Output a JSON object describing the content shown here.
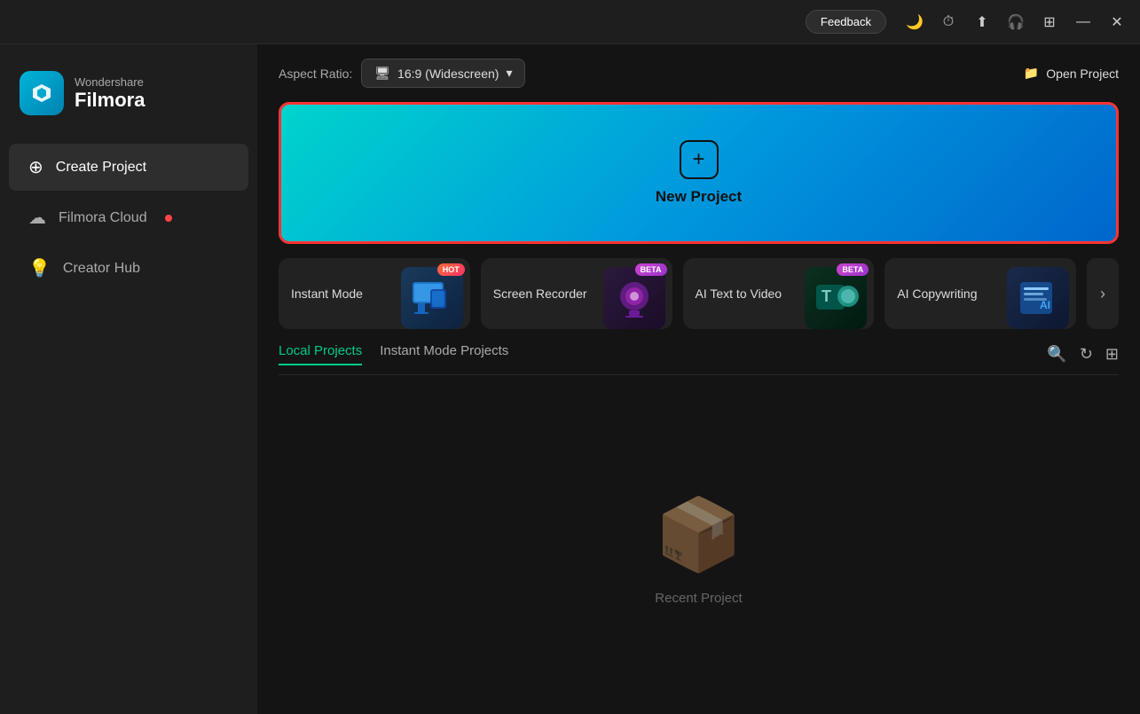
{
  "titleBar": {
    "feedback": "Feedback",
    "minimize": "—",
    "restore": "⊡",
    "close": "✕"
  },
  "logo": {
    "wonder": "Wondershare",
    "filmora": "Filmora"
  },
  "nav": {
    "createProject": "Create Project",
    "filmoraCloud": "Filmora Cloud",
    "creatorHub": "Creator Hub"
  },
  "topBar": {
    "aspectLabel": "Aspect Ratio:",
    "aspectValue": "16:9 (Widescreen)",
    "openProject": "Open Project"
  },
  "newProject": {
    "label": "New Project"
  },
  "featureCards": [
    {
      "label": "Instant Mode",
      "badge": "HOT"
    },
    {
      "label": "Screen Recorder",
      "badge": "BETA"
    },
    {
      "label": "AI Text to Video",
      "badge": "BETA"
    },
    {
      "label": "AI Copywriting",
      "badge": ""
    }
  ],
  "projects": {
    "tabs": [
      "Local Projects",
      "Instant Mode Projects"
    ],
    "activeTab": 0,
    "emptyLabel": "Recent Project"
  }
}
